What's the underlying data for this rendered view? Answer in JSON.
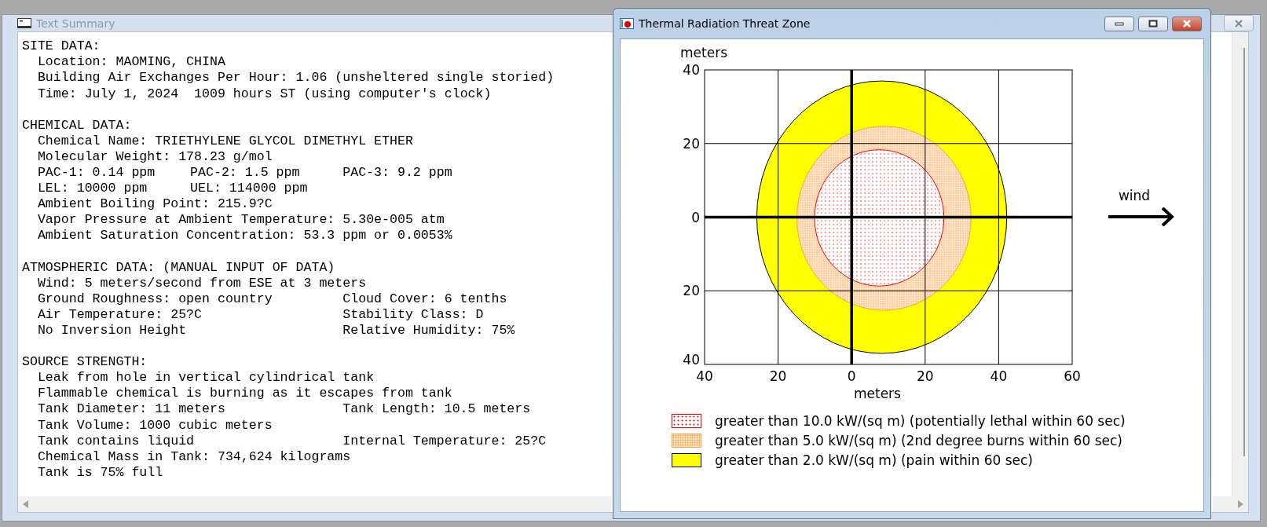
{
  "summary_window": {
    "title": "Text Summary",
    "sections": [
      {
        "heading": "SITE DATA:",
        "lines": [
          [
            "Location: MAOMING, CHINA"
          ],
          [
            "Building Air Exchanges Per Hour: 1.06 (unsheltered single storied)"
          ],
          [
            "Time: July 1, 2024  1009 hours ST (using computer's clock)"
          ]
        ]
      },
      {
        "heading": "CHEMICAL DATA:",
        "lines": [
          [
            "Chemical Name: TRIETHYLENE GLYCOL DIMETHYL ETHER"
          ],
          [
            "Molecular Weight: 178.23 g/mol"
          ],
          [
            "PAC-1: 0.14 ppm",
            "PAC-2: 1.5 ppm",
            "PAC-3: 9.2 ppm"
          ],
          [
            "LEL: 10000 ppm",
            "UEL: 114000 ppm"
          ],
          [
            "Ambient Boiling Point: 215.9?C"
          ],
          [
            "Vapor Pressure at Ambient Temperature: 5.30e-005 atm"
          ],
          [
            "Ambient Saturation Concentration: 53.3 ppm or 0.0053%"
          ]
        ]
      },
      {
        "heading": "ATMOSPHERIC DATA: (MANUAL INPUT OF DATA)",
        "lines": [
          [
            "Wind: 5 meters/second from ESE at 3 meters"
          ],
          [
            "Ground Roughness: open country",
            "Cloud Cover: 6 tenths"
          ],
          [
            "Air Temperature: 25?C",
            "Stability Class: D"
          ],
          [
            "No Inversion Height",
            "Relative Humidity: 75%"
          ]
        ]
      },
      {
        "heading": "SOURCE STRENGTH:",
        "lines": [
          [
            "Leak from hole in vertical cylindrical tank"
          ],
          [
            "Flammable chemical is burning as it escapes from tank"
          ],
          [
            "Tank Diameter: 11 meters",
            "Tank Length: 10.5 meters"
          ],
          [
            "Tank Volume: 1000 cubic meters"
          ],
          [
            "Tank contains liquid",
            "Internal Temperature: 25?C"
          ],
          [
            "Chemical Mass in Tank: 734,624 kilograms"
          ],
          [
            "Tank is 75% full"
          ]
        ]
      }
    ]
  },
  "threat_window": {
    "title": "Thermal Radiation Threat Zone",
    "plot": {
      "y_label": "meters",
      "x_label": "meters",
      "y_ticks": [
        "40",
        "20",
        "0",
        "20",
        "40"
      ],
      "x_ticks": [
        "40",
        "20",
        "0",
        "20",
        "40",
        "60"
      ],
      "wind_label": "wind"
    },
    "legend": [
      {
        "kind": "dotted",
        "color": "#ff0000",
        "label": "greater than 10.0 kW/(sq m) (potentially lethal within 60 sec)"
      },
      {
        "kind": "stippled",
        "color": "#ffa040",
        "label": "greater than 5.0 kW/(sq m) (2nd degree burns within 60 sec)"
      },
      {
        "kind": "solid",
        "color": "#ffff00",
        "label": "greater than 2.0 kW/(sq m) (pain within 60 sec)"
      }
    ]
  }
}
